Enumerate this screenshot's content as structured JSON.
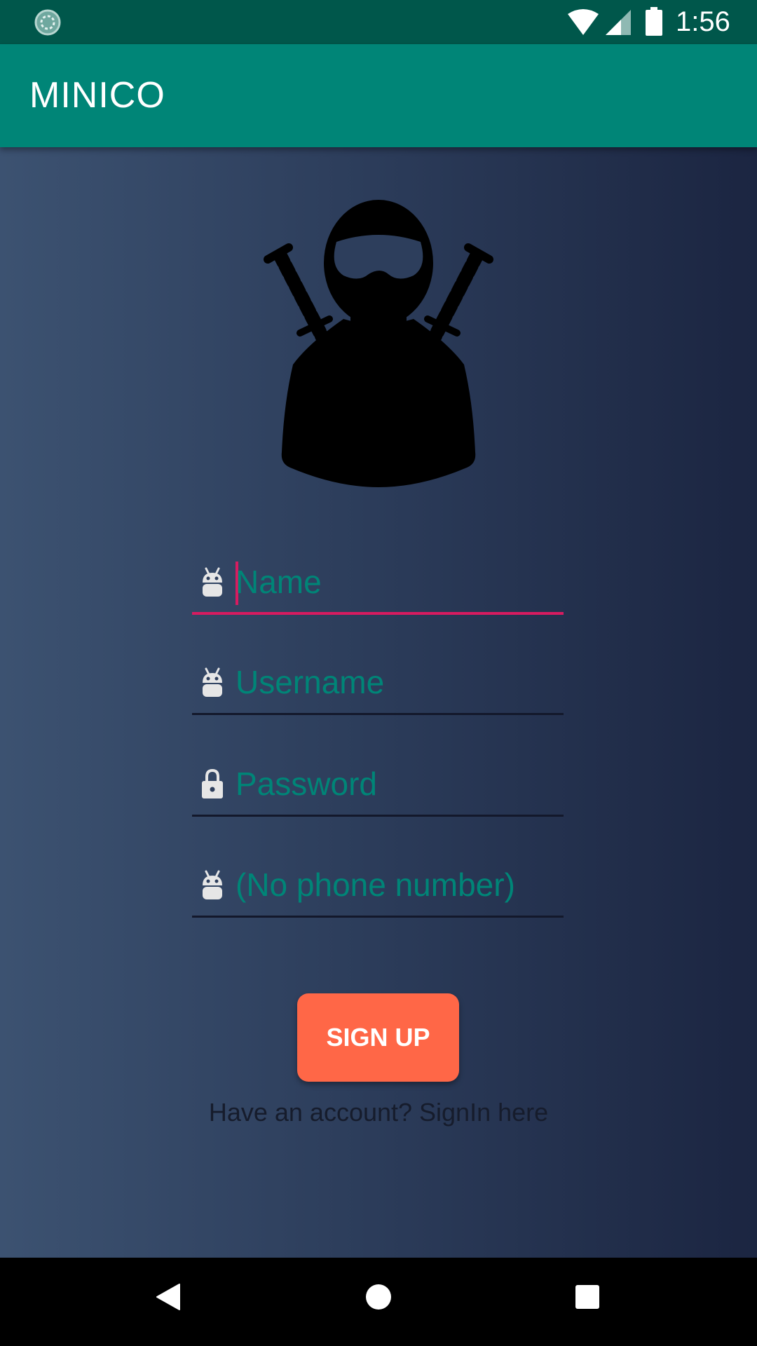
{
  "status_bar": {
    "time": "1:56",
    "icons": [
      "sync-icon",
      "wifi-icon",
      "cell-signal-icon",
      "battery-icon"
    ]
  },
  "app_bar": {
    "title": "MINICO",
    "color": "#008577"
  },
  "logo": {
    "icon": "ninja-icon"
  },
  "form": {
    "fields": [
      {
        "placeholder": "Name",
        "value": "",
        "icon": "android-icon",
        "focused": true
      },
      {
        "placeholder": "Username",
        "value": "",
        "icon": "android-icon"
      },
      {
        "placeholder": "Password",
        "value": "",
        "icon": "lock-icon"
      },
      {
        "placeholder": "(No phone number)",
        "value": "",
        "icon": "android-icon"
      }
    ],
    "signup_label": "SIGN UP",
    "signin_text": "Have an account? SignIn here"
  },
  "nav_bar": {
    "icons": [
      "back-icon",
      "home-icon",
      "recents-icon"
    ]
  },
  "colors": {
    "accent": "#D81B60",
    "primary": "#008577",
    "primary_dark": "#00574B",
    "button": "#FF6747"
  }
}
